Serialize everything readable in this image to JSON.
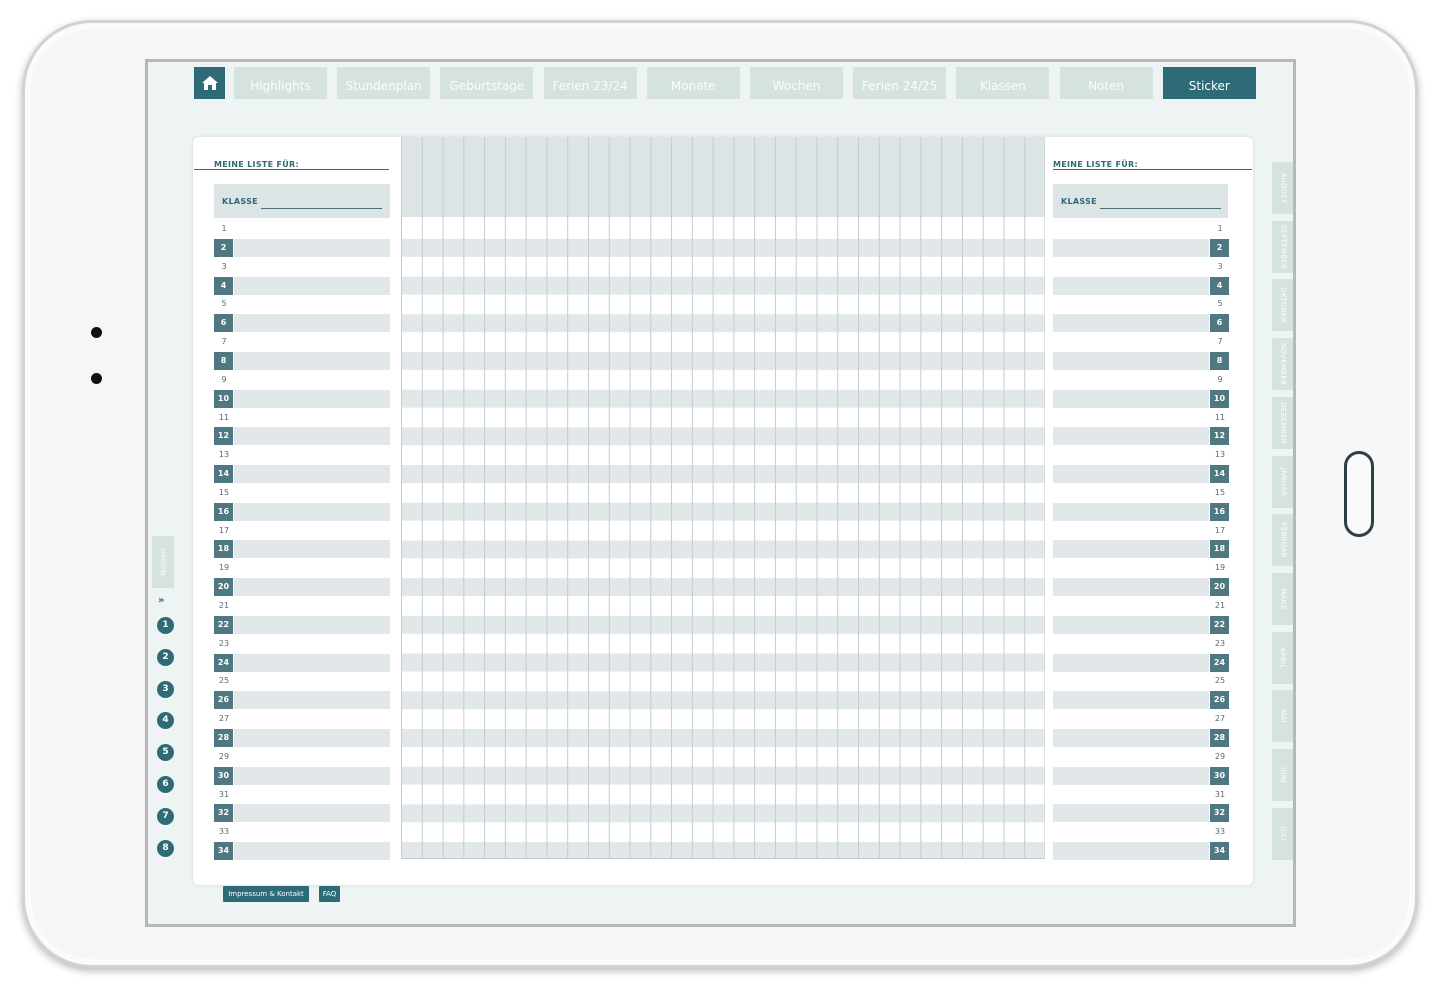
{
  "nav": {
    "tabs": [
      "Highlights",
      "Stundenplan",
      "Geburtstage",
      "Ferien 23/24",
      "Monate",
      "Wochen",
      "Ferien 24/25",
      "Klassen",
      "Noten",
      "Sticker"
    ],
    "active_tab": "Sticker",
    "home_icon": "home-icon"
  },
  "left_list": {
    "title": "MEINE LISTE FÜR:",
    "klasse_label": "KLASSE"
  },
  "right_list": {
    "title": "MEINE LISTE FÜR:",
    "klasse_label": "KLASSE"
  },
  "row_numbers": [
    "1",
    "2",
    "3",
    "4",
    "5",
    "6",
    "7",
    "8",
    "9",
    "10",
    "11",
    "12",
    "13",
    "14",
    "15",
    "16",
    "17",
    "18",
    "19",
    "20",
    "21",
    "22",
    "23",
    "24",
    "25",
    "26",
    "27",
    "28",
    "29",
    "30",
    "31",
    "32",
    "33",
    "34"
  ],
  "grid": {
    "columns": 31
  },
  "side_nav": {
    "notes_label": "Notizen",
    "collapse_icon": "double-chevron-down-icon",
    "pages": [
      "1",
      "2",
      "3",
      "4",
      "5",
      "6",
      "7",
      "8"
    ]
  },
  "months": [
    "AUGUST",
    "SEPTEMBER",
    "OKTOBER",
    "NOVEMBER",
    "DEZEMBER",
    "JANUAR",
    "FEBRUAR",
    "MÄRZ",
    "APRIL",
    "MAI",
    "JUNI",
    "JULI"
  ],
  "footer": {
    "impressum": "Impressum & Kontakt",
    "faq": "FAQ"
  },
  "colors": {
    "accent": "#2f6a77",
    "tab_inactive": "#d5e2dd",
    "stripe": "#e2e8ea",
    "badge": "#4f7882"
  }
}
